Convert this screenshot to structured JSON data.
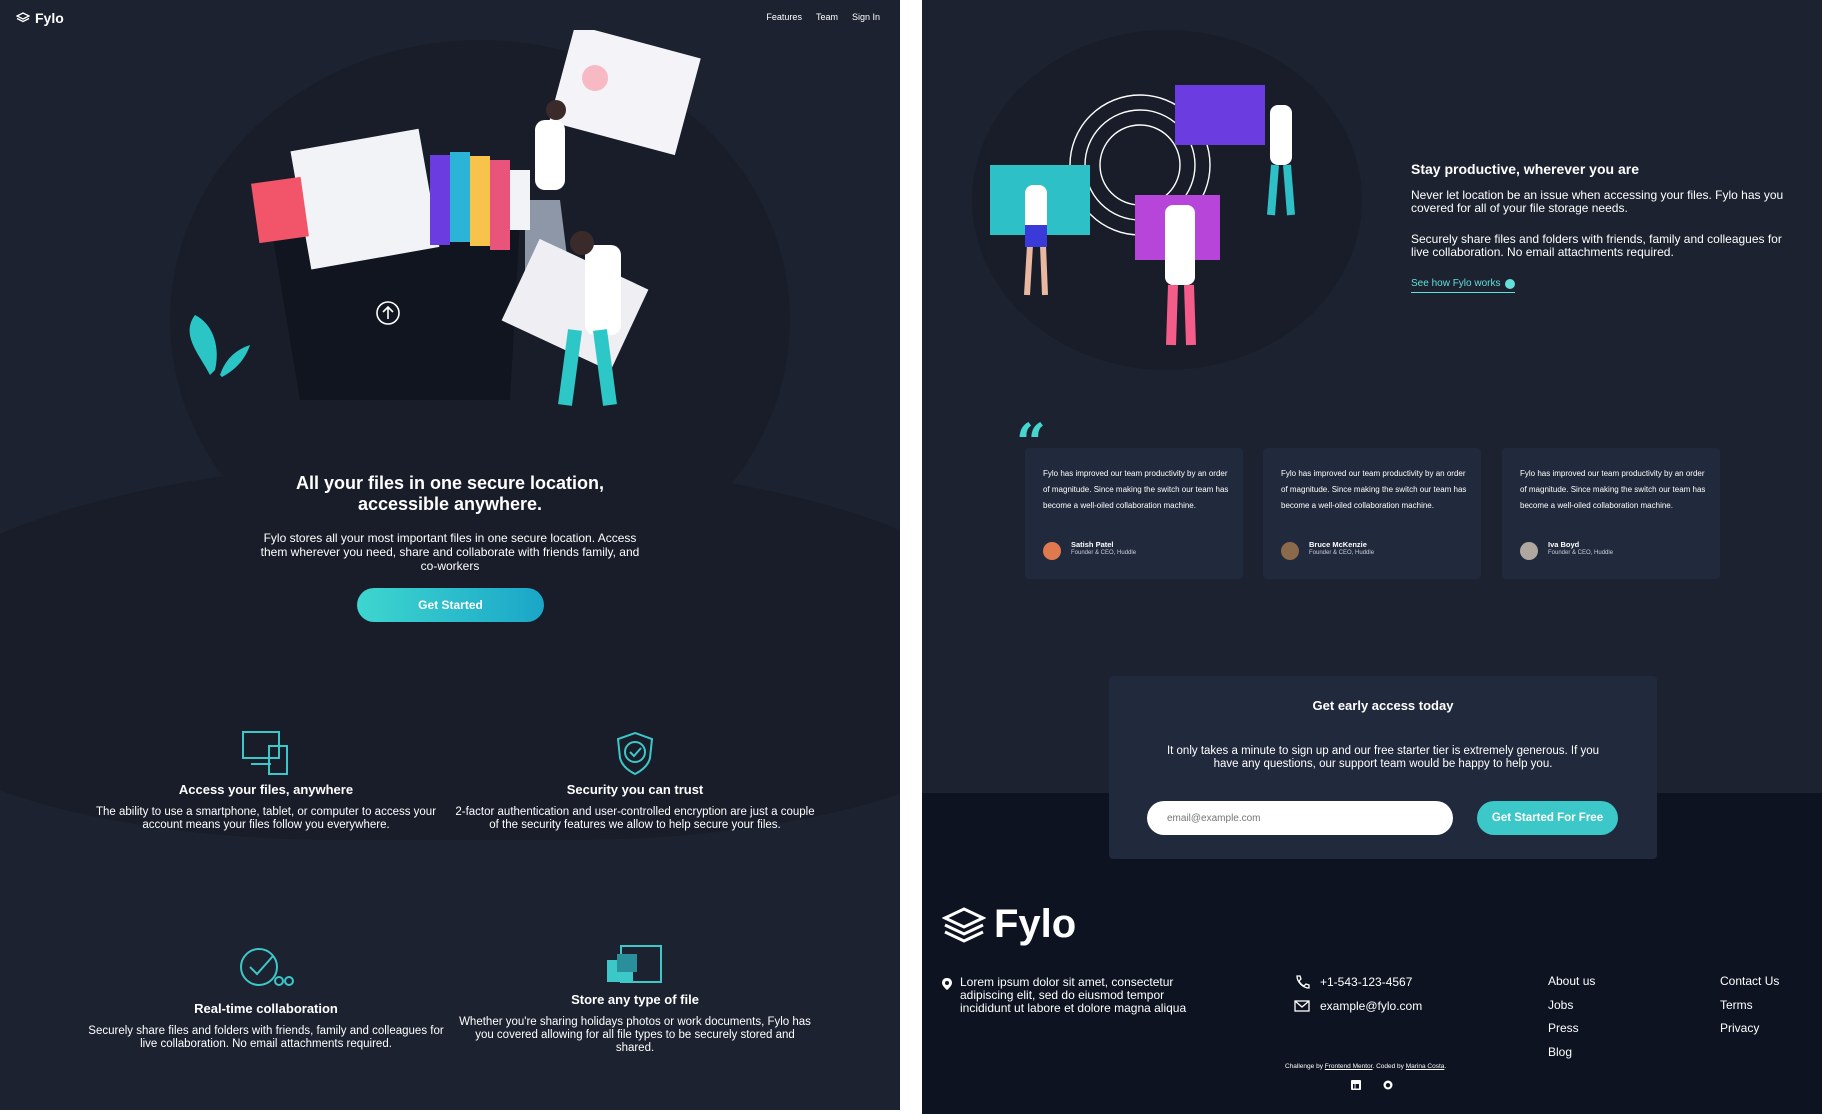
{
  "left": {
    "logo": "Fylo",
    "nav": [
      "Features",
      "Team",
      "Sign In"
    ],
    "hero": {
      "title": "All your files in one secure location, accessible anywhere.",
      "text": "Fylo stores all your most important files in one secure location. Access them wherever you need, share and collaborate with friends family, and co-workers",
      "button": "Get Started"
    },
    "features": [
      {
        "title": "Access your files, anywhere",
        "text": "The ability to use a smartphone, tablet, or computer to access your account means your files follow you everywhere."
      },
      {
        "title": "Security you can trust",
        "text": "2-factor authentication and user-controlled encryption are just a couple of the security features we allow to help secure your files."
      },
      {
        "title": "Real-time collaboration",
        "text": "Securely share files and folders with friends, family and colleagues for live collaboration. No email attachments required."
      },
      {
        "title": "Store any type of file",
        "text": "Whether you're sharing holidays photos or work documents, Fylo has you covered allowing for all file types to be securely stored and shared."
      }
    ]
  },
  "right": {
    "productive": {
      "title": "Stay productive, wherever you are",
      "p1": "Never let location be an issue when accessing your files. Fylo has you covered for all of your file storage needs.",
      "p2": "Securely share files and folders with friends, family and colleagues for live collaboration. No email attachments required.",
      "link": "See how Fylo works"
    },
    "quote_mark": "“",
    "testimonials": [
      {
        "text": "Fylo has improved our team productivity by an order of magnitude. Since making the switch our team has become a well-oiled collaboration machine.",
        "name": "Satish Patel",
        "role": "Founder & CEO, Huddle"
      },
      {
        "text": "Fylo has improved our team productivity by an order of magnitude. Since making the switch our team has become a well-oiled collaboration machine.",
        "name": "Bruce McKenzie",
        "role": "Founder & CEO, Huddle"
      },
      {
        "text": "Fylo has improved our team productivity by an order of magnitude. Since making the switch our team has become a well-oiled collaboration machine.",
        "name": "Iva Boyd",
        "role": "Founder & CEO, Huddle"
      }
    ],
    "access": {
      "title": "Get early access today",
      "text": "It only takes a minute to sign up and our free starter tier is extremely generous. If you have any questions, our support team would be happy to help you.",
      "placeholder": "email@example.com",
      "button": "Get Started For Free"
    },
    "footer": {
      "logo": "Fylo",
      "address": "Lorem ipsum dolor sit amet, consectetur adipiscing elit, sed do eiusmod tempor incididunt ut labore et dolore magna aliqua",
      "phone": "+1-543-123-4567",
      "email": "example@fylo.com",
      "links_col1": [
        "About us",
        "Jobs",
        "Press",
        "Blog"
      ],
      "links_col2": [
        "Contact Us",
        "Terms",
        "Privacy"
      ],
      "credit_prefix": "Challenge by",
      "credit_fm": "Frontend Mentor",
      "credit_mid": ". Coded by",
      "credit_author": "Marina Costa",
      "credit_suffix": "."
    }
  },
  "colors": {
    "bg": "#1c2230",
    "card": "#21293c",
    "footer": "#0d1321",
    "accent": "#3cc7c8"
  },
  "icons": [
    "layers-logo-icon",
    "upload-arrow-icon",
    "devices-icon",
    "shield-check-icon",
    "collaboration-icon",
    "files-icon",
    "location-pin-icon",
    "phone-icon",
    "email-icon",
    "linkedin-icon",
    "github-icon"
  ]
}
